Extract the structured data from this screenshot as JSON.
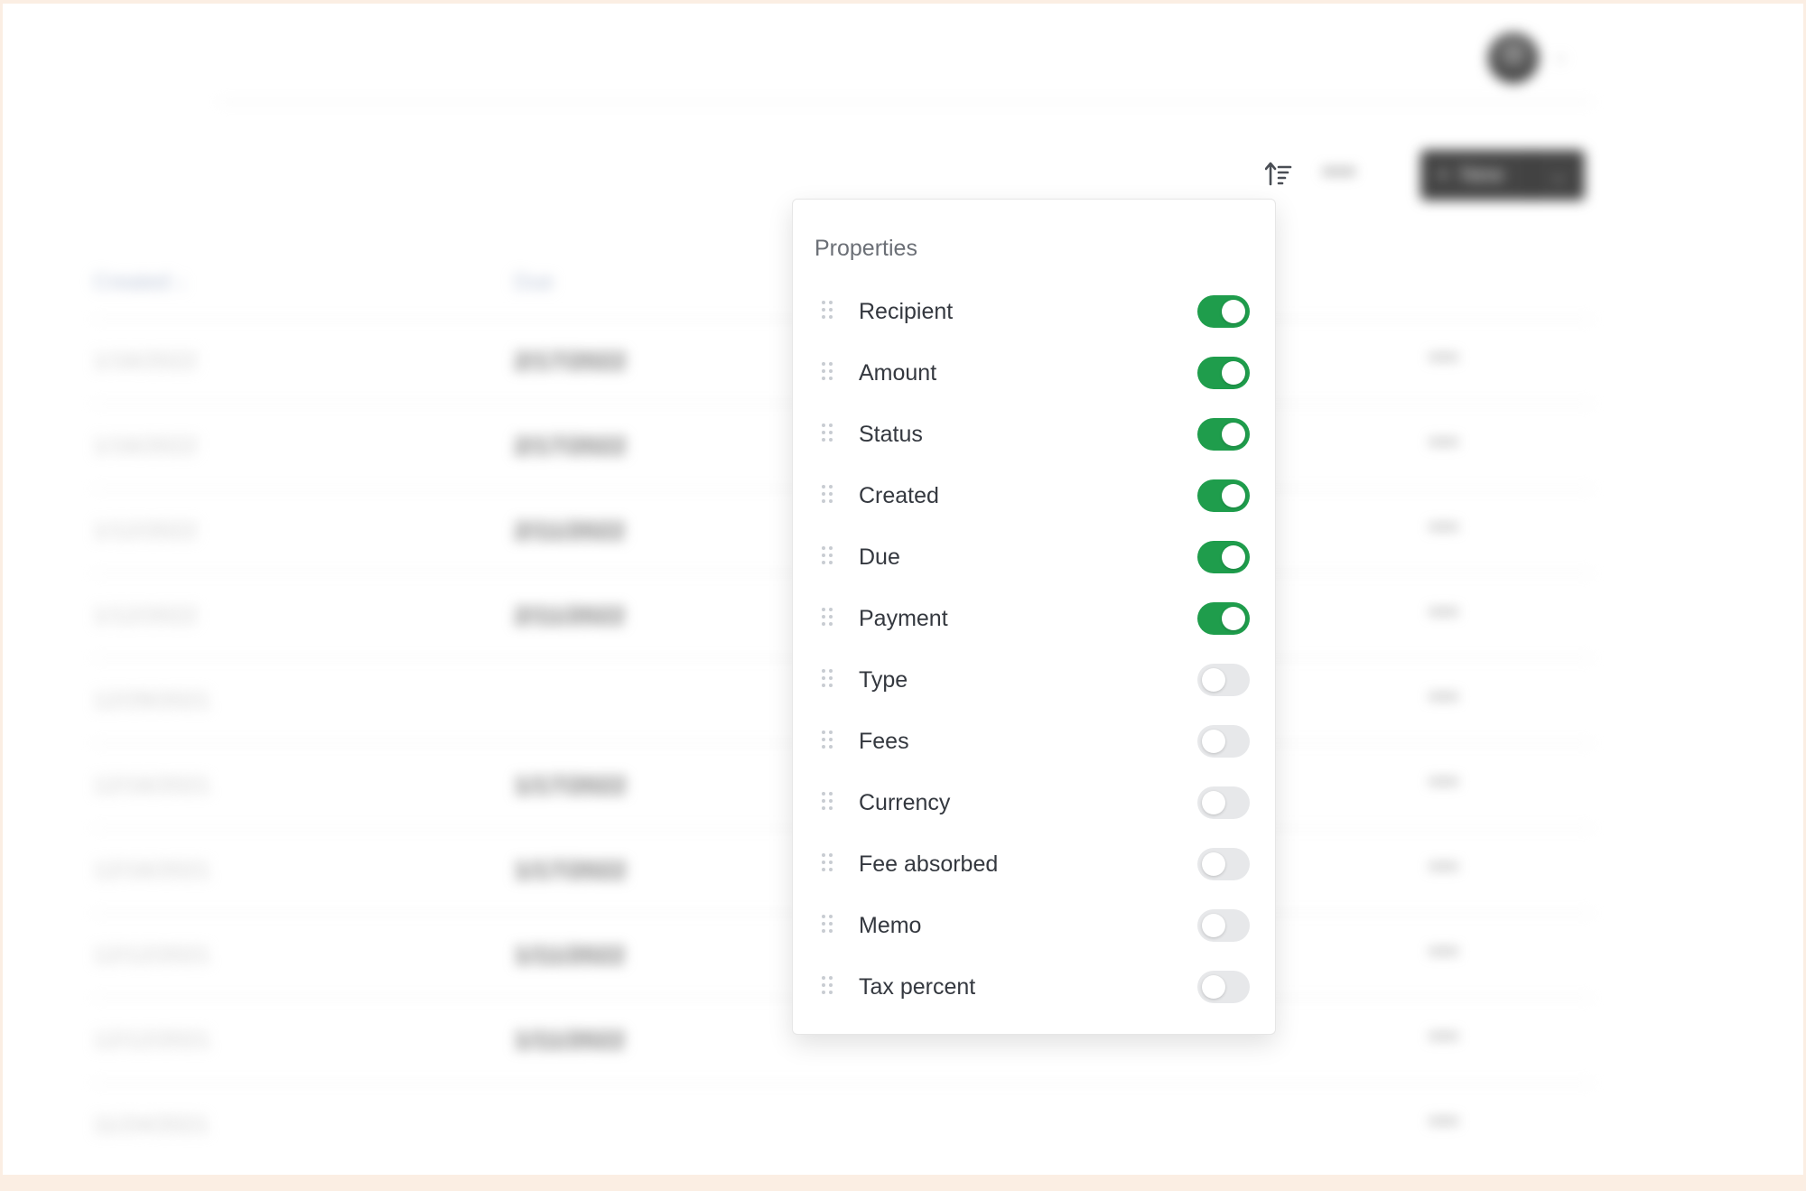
{
  "colors": {
    "toggle_on": "#1f9d4c",
    "toggle_off": "#e7e8ea",
    "page_margin": "#fbeee3"
  },
  "header": {
    "avatar_icon": "user-avatar",
    "chevron_icon": "chevron-down-icon"
  },
  "toolbar": {
    "sort_icon": "sort-ascending-icon",
    "more_icon": "more-horizontal-icon",
    "new_label": "New",
    "new_plus_icon": "plus-icon",
    "new_caret_icon": "chevron-down-icon"
  },
  "table": {
    "columns": [
      "Created ↓",
      "Due"
    ],
    "rows": [
      {
        "created": "1/16/2022",
        "due": "2/17/2022"
      },
      {
        "created": "1/16/2022",
        "due": "2/17/2022"
      },
      {
        "created": "1/12/2022",
        "due": "2/11/2022"
      },
      {
        "created": "1/12/2022",
        "due": "2/11/2022"
      },
      {
        "created": "12/29/2021",
        "due": ""
      },
      {
        "created": "12/16/2021",
        "due": "1/17/2022"
      },
      {
        "created": "12/16/2021",
        "due": "1/17/2022"
      },
      {
        "created": "12/12/2021",
        "due": "1/11/2022"
      },
      {
        "created": "12/12/2021",
        "due": "1/11/2022"
      },
      {
        "created": "11/24/2021",
        "due": ""
      }
    ],
    "row_more": "•••"
  },
  "properties_panel": {
    "title": "Properties",
    "items": [
      {
        "label": "Recipient",
        "enabled": true
      },
      {
        "label": "Amount",
        "enabled": true
      },
      {
        "label": "Status",
        "enabled": true
      },
      {
        "label": "Created",
        "enabled": true
      },
      {
        "label": "Due",
        "enabled": true
      },
      {
        "label": "Payment",
        "enabled": true
      },
      {
        "label": "Type",
        "enabled": false
      },
      {
        "label": "Fees",
        "enabled": false
      },
      {
        "label": "Currency",
        "enabled": false
      },
      {
        "label": "Fee absorbed",
        "enabled": false
      },
      {
        "label": "Memo",
        "enabled": false
      },
      {
        "label": "Tax percent",
        "enabled": false
      }
    ]
  }
}
